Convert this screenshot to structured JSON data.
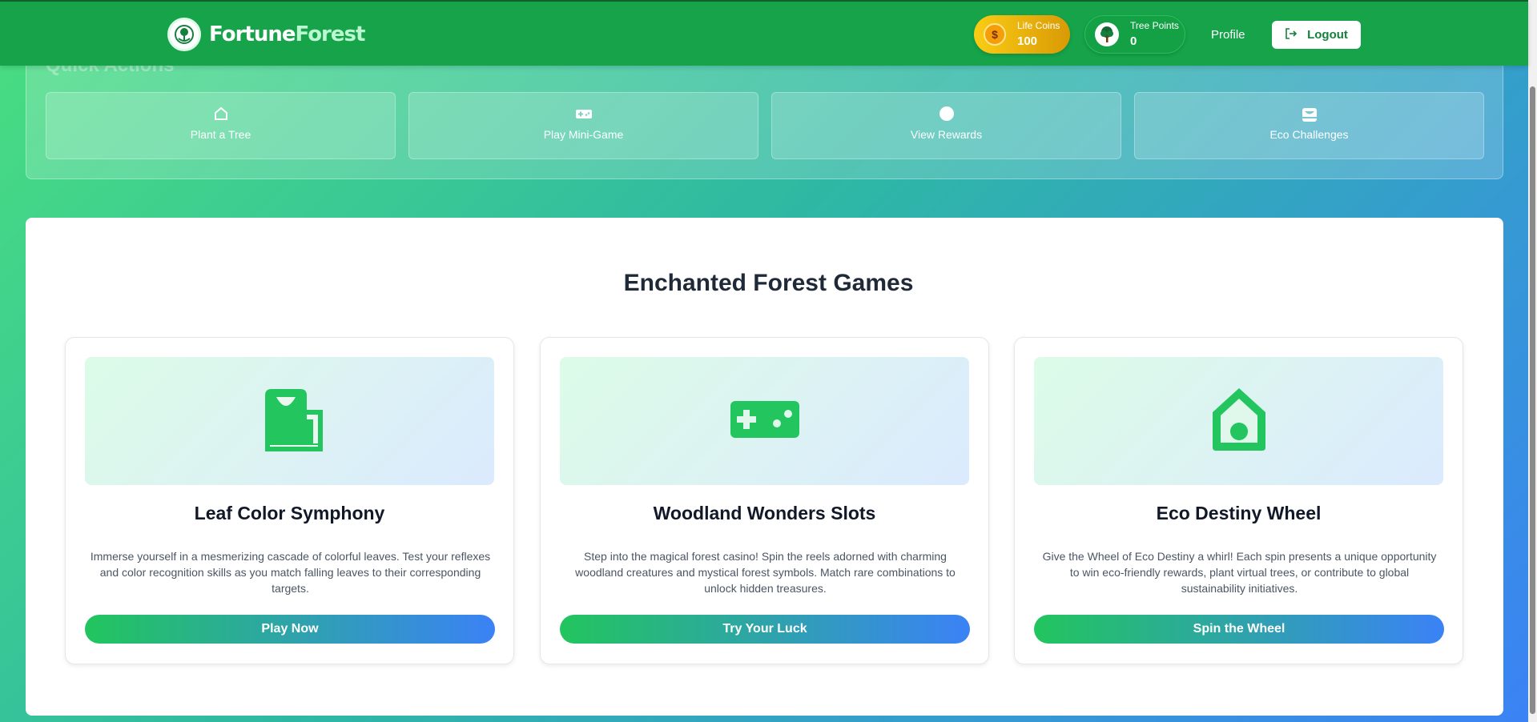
{
  "header": {
    "logo_part1": "Fortune",
    "logo_part2": "Forest",
    "coins": {
      "label": "Life Coins",
      "value": "100",
      "symbol": "$"
    },
    "points": {
      "label": "Tree Points",
      "value": "0"
    },
    "profile_label": "Profile",
    "logout_label": "Logout"
  },
  "quick_actions": {
    "title": "Quick Actions",
    "items": [
      {
        "label": "Plant a Tree",
        "icon": "home-icon"
      },
      {
        "label": "Play Mini-Game",
        "icon": "gamepad-icon"
      },
      {
        "label": "View Rewards",
        "icon": "circle-icon"
      },
      {
        "label": "Eco Challenges",
        "icon": "inbox-icon"
      }
    ]
  },
  "games": {
    "title": "Enchanted Forest Games",
    "cards": [
      {
        "name": "Leaf Color Symphony",
        "description": "Immerse yourself in a mesmerizing cascade of colorful leaves. Test your reflexes and color recognition skills as you match falling leaves to their corresponding targets.",
        "button": "Play Now",
        "icon": "inbox-icon"
      },
      {
        "name": "Woodland Wonders Slots",
        "description": "Step into the magical forest casino! Spin the reels adorned with charming woodland creatures and mystical forest symbols. Match rare combinations to unlock hidden treasures.",
        "button": "Try Your Luck",
        "icon": "gamepad-icon"
      },
      {
        "name": "Eco Destiny Wheel",
        "description": "Give the Wheel of Eco Destiny a whirl! Each spin presents a unique opportunity to win eco-friendly rewards, plant virtual trees, or contribute to global sustainability initiatives.",
        "button": "Spin the Wheel",
        "icon": "home-icon"
      }
    ]
  },
  "colors": {
    "header_green": "#16a34a",
    "accent_green": "#22c55e",
    "accent_blue": "#3b82f6",
    "coin_gold": "#facc15"
  }
}
